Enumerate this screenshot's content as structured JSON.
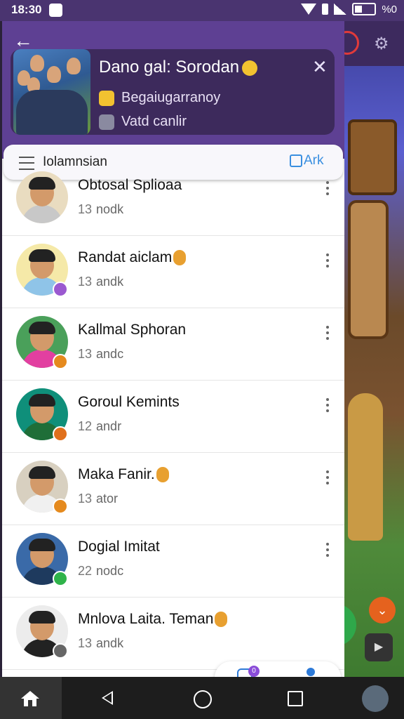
{
  "status_bar": {
    "time": "18:30",
    "battery_text": "%0"
  },
  "header": {
    "group_name": "Dano gal: Sorodan",
    "subtitle": "Begaiugarranoy",
    "detail": "Vatd canlir"
  },
  "search": {
    "label": "Iolamnsian",
    "mark_label": "Ark"
  },
  "members": [
    {
      "name": "Obtosal Splioaa",
      "meta": "nodk",
      "emoji": false,
      "badge": "",
      "shirt": "#c8c8c8"
    },
    {
      "name": "Randat aiclam",
      "meta": "andk",
      "emoji": true,
      "badge": "#9b59d0",
      "shirt": "#8fc4e8"
    },
    {
      "name": "Kallmal Sphoran",
      "meta": "andc",
      "emoji": false,
      "badge": "#e58a1e",
      "shirt": "#e23fa0"
    },
    {
      "name": "Goroul Kemints",
      "meta": "andr",
      "emoji": false,
      "badge": "#e0701c",
      "shirt": "#1f6e38"
    },
    {
      "name": "Maka Fanir.",
      "meta": "ator",
      "emoji": true,
      "badge": "#e58a1e",
      "shirt": "#f0f0f0"
    },
    {
      "name": "Dogial Imitat",
      "meta": "nodc",
      "emoji": false,
      "badge": "#2fb34a",
      "shirt": "#1e3a5e"
    },
    {
      "name": "Mnlova Laita. Teman",
      "meta": "andk",
      "emoji": true,
      "badge": "#666",
      "shirt": "#222"
    }
  ],
  "meta_counts": [
    "13",
    "13",
    "13",
    "12",
    "13",
    "22",
    "13"
  ],
  "float_actions": {
    "chat_badge": "0"
  },
  "colors": {
    "header": "#5e4093",
    "accent": "#3a8fe0",
    "card": "#3d2a5c"
  },
  "icons": [
    "back-arrow-icon",
    "close-icon",
    "menu-icon",
    "mark-icon",
    "more-vert-icon",
    "chat-icon",
    "add-person-icon",
    "nav-back-icon",
    "nav-home-icon",
    "nav-recents-icon"
  ]
}
